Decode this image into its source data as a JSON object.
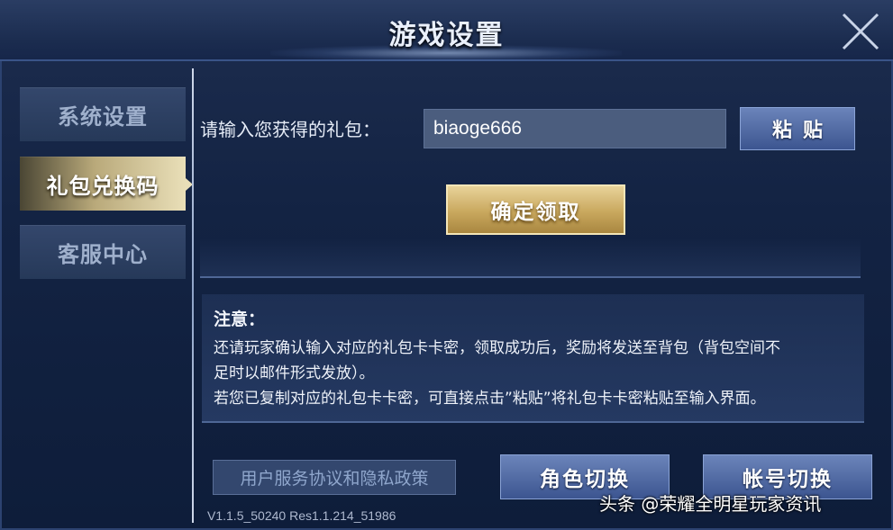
{
  "header": {
    "title": "游戏设置"
  },
  "sidebar": {
    "items": [
      {
        "label": "系统设置",
        "active": false
      },
      {
        "label": "礼包兑换码",
        "active": true
      },
      {
        "label": "客服中心",
        "active": false
      }
    ]
  },
  "redeem": {
    "label": "请输入您获得的礼包：",
    "input_value": "biaoge666",
    "paste_label": "粘贴",
    "confirm_label": "确定领取"
  },
  "notice": {
    "title": "注意：",
    "lines": [
      "还请玩家确认输入对应的礼包卡卡密，领取成功后，奖励将发送至背包（背包空间不",
      "足时以邮件形式发放）。",
      "若您已复制对应的礼包卡卡密，可直接点击”粘贴”将礼包卡卡密粘贴至输入界面。"
    ]
  },
  "footer": {
    "policy_label": "用户服务协议和隐私政策",
    "role_switch_label": "角色切换",
    "account_switch_label": "帐号切换",
    "version": "V1.1.5_50240 Res1.1.214_51986"
  },
  "watermark": {
    "text": "头条 @荣耀全明星玩家资讯"
  },
  "icons": {
    "close": "close-icon"
  },
  "colors": {
    "accent_gold": "#e9dfb8",
    "button_blue": "#4c66a3",
    "background": "#132343"
  }
}
